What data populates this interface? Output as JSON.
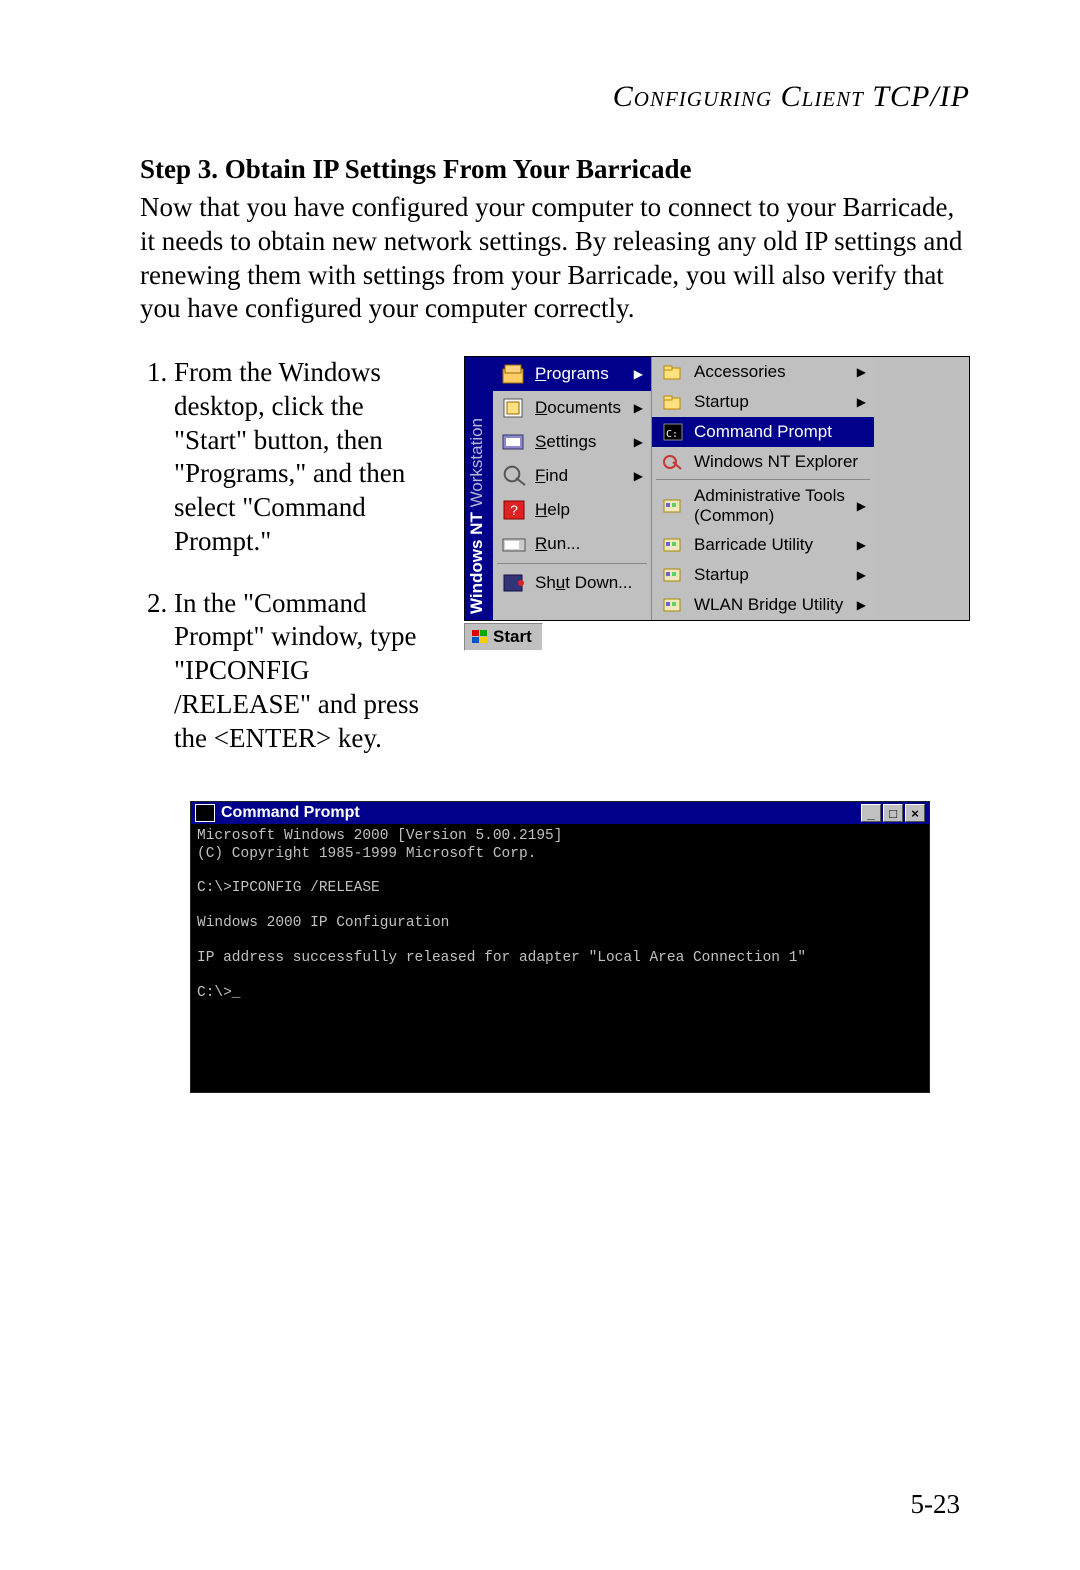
{
  "header": "Configuring Client TCP/IP",
  "step_title": "Step 3. Obtain IP Settings From Your Barricade",
  "intro_para": "Now that you have configured your computer to connect to your Barricade, it needs to obtain new network settings. By releasing any old IP settings and renewing them with settings from your Barricade, you will also verify that you have configured your computer correctly.",
  "steps": [
    "From the Windows desktop, click the \"Start\" button, then \"Programs,\" and then select \"Command Prompt.\"",
    "In the \"Command Prompt\" window, type \"IPCONFIG /RELEASE\" and press the <ENTER> key."
  ],
  "startmenu": {
    "sidebar_bold": "Windows NT",
    "sidebar_light": " Workstation",
    "left": [
      {
        "key": "P",
        "rest": "rograms",
        "arrow": true,
        "sel": true,
        "icon": "programs"
      },
      {
        "key": "D",
        "rest": "ocuments",
        "arrow": true,
        "icon": "documents"
      },
      {
        "key": "S",
        "rest": "ettings",
        "arrow": true,
        "icon": "settings"
      },
      {
        "key": "F",
        "rest": "ind",
        "arrow": true,
        "icon": "find"
      },
      {
        "key": "H",
        "rest": "elp",
        "arrow": false,
        "icon": "help"
      },
      {
        "key": "R",
        "rest": "un...",
        "arrow": false,
        "icon": "run"
      },
      {
        "sep": true
      },
      {
        "pre": "Sh",
        "key": "u",
        "rest": "t Down...",
        "arrow": false,
        "icon": "shutdown"
      }
    ],
    "right": [
      {
        "label": "Accessories",
        "arrow": true,
        "icon": "folder"
      },
      {
        "label": "Startup",
        "arrow": true,
        "icon": "folder"
      },
      {
        "label": "Command Prompt",
        "arrow": false,
        "icon": "cmd",
        "sel": true
      },
      {
        "label": "Windows NT Explorer",
        "arrow": false,
        "icon": "explorer"
      },
      {
        "sep": true
      },
      {
        "label": "Administrative Tools (Common)",
        "arrow": true,
        "icon": "group"
      },
      {
        "label": "Barricade Utility",
        "arrow": true,
        "icon": "group"
      },
      {
        "label": "Startup",
        "arrow": true,
        "icon": "group"
      },
      {
        "label": "WLAN Bridge Utility",
        "arrow": true,
        "icon": "group"
      }
    ],
    "start_label": "Start"
  },
  "cmd": {
    "title": "Command Prompt",
    "lines": [
      "Microsoft Windows 2000 [Version 5.00.2195]",
      "(C) Copyright 1985-1999 Microsoft Corp.",
      "",
      "C:\\>IPCONFIG /RELEASE",
      "",
      "Windows 2000 IP Configuration",
      "",
      "IP address successfully released for adapter \"Local Area Connection 1\"",
      "",
      "C:\\>_"
    ]
  },
  "page_number": "5-23"
}
